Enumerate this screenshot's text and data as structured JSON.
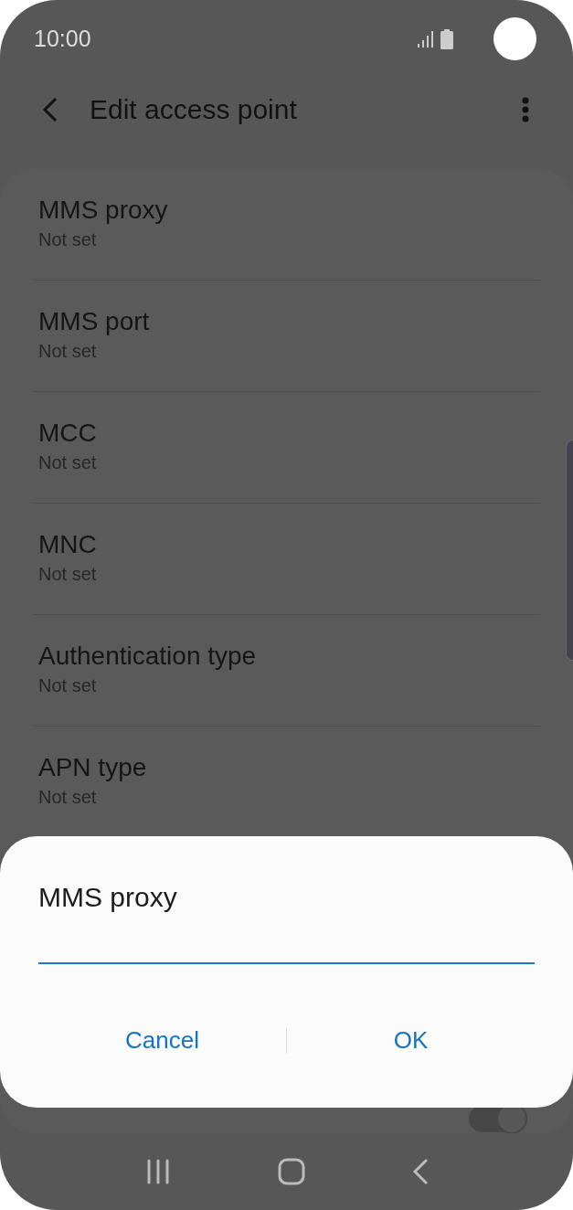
{
  "status_bar": {
    "time": "10:00"
  },
  "header": {
    "title": "Edit access point"
  },
  "settings": [
    {
      "kind": "text",
      "title": "MMS proxy",
      "value": "Not set"
    },
    {
      "kind": "text",
      "title": "MMS port",
      "value": "Not set"
    },
    {
      "kind": "text",
      "title": "MCC",
      "value": "Not set"
    },
    {
      "kind": "text",
      "title": "MNC",
      "value": "Not set"
    },
    {
      "kind": "text",
      "title": "Authentication type",
      "value": "Not set"
    },
    {
      "kind": "text",
      "title": "APN type",
      "value": "Not set"
    },
    {
      "kind": "hidden"
    },
    {
      "kind": "toggle",
      "on": true
    }
  ],
  "dialog": {
    "title": "MMS proxy",
    "buttons": [
      "Cancel",
      "OK"
    ]
  }
}
